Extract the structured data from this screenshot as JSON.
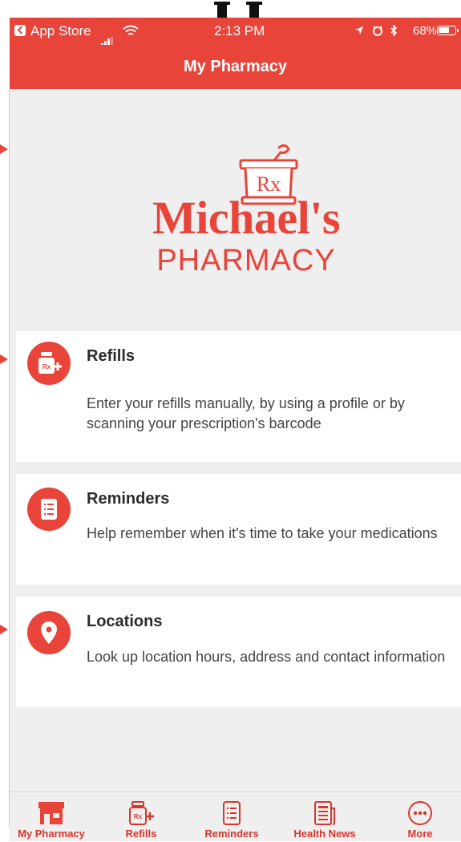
{
  "status_bar": {
    "back_app": "App Store",
    "time": "2:13 PM",
    "battery": "68%"
  },
  "nav": {
    "title": "My Pharmacy"
  },
  "logo": {
    "name": "Michael's",
    "subtitle": "PHARMACY",
    "rx": "Rx"
  },
  "cards": [
    {
      "title": "Refills",
      "description": "Enter your refills manually, by using a profile or by scanning your prescription's barcode",
      "icon": "rx-bottle-icon"
    },
    {
      "title": "Reminders",
      "description": "Help remember when it's time to take your medications",
      "icon": "list-icon"
    },
    {
      "title": "Locations",
      "description": "Look up location hours, address and contact information",
      "icon": "location-pin-icon"
    }
  ],
  "tabs": [
    {
      "label": "My Pharmacy",
      "icon": "store-icon",
      "selected": true
    },
    {
      "label": "Refills",
      "icon": "rx-bottle-icon"
    },
    {
      "label": "Reminders",
      "icon": "list-icon"
    },
    {
      "label": "Health News",
      "icon": "newspaper-icon"
    },
    {
      "label": "More",
      "icon": "more-icon"
    }
  ],
  "colors": {
    "accent": "#e8443a",
    "background": "#efefef",
    "card": "#ffffff"
  }
}
